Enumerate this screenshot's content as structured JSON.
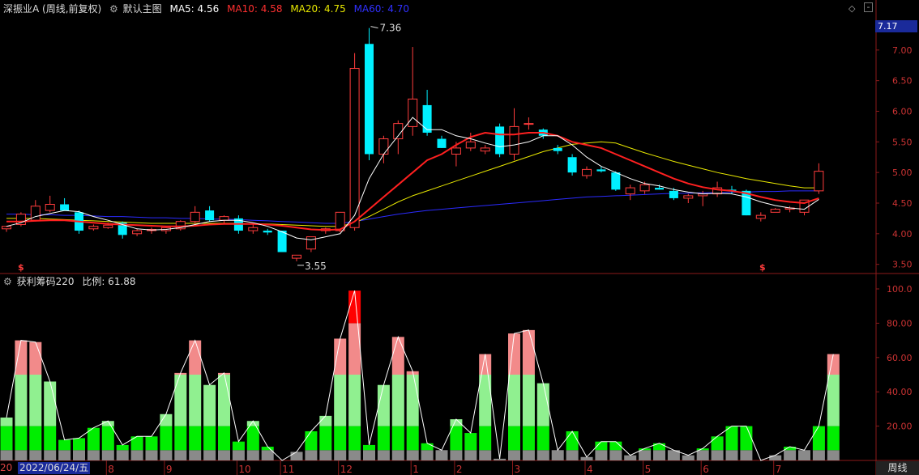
{
  "header": {
    "stock_name": "深振业A (周线,前复权)",
    "main_chart_label": "默认主图",
    "ma5": "MA5: 4.56",
    "ma10": "MA10: 4.58",
    "ma20": "MA20: 4.75",
    "ma60": "MA60: 4.70",
    "colors": {
      "ma5": "#ffffff",
      "ma10": "#ff2020",
      "ma20": "#e8e800",
      "ma60": "#2b2bff"
    }
  },
  "sub_header": {
    "indicator": "获利筹码220",
    "ratio": "比例: 61.88"
  },
  "current_price": "7.17",
  "price_axis": [
    "7.00",
    "6.50",
    "6.00",
    "5.50",
    "5.00",
    "4.50",
    "4.00",
    "3.50"
  ],
  "sub_axis": [
    "100.0",
    "80.00",
    "60.00",
    "40.00",
    "20.00"
  ],
  "annotations": {
    "high": "7.36",
    "low": "3.55"
  },
  "x_axis": {
    "date_label": "2022/06/24/五",
    "left_edge": "20",
    "months": [
      "8",
      "9",
      "10",
      "11",
      "12",
      "1",
      "2",
      "3",
      "4",
      "5",
      "6",
      "7"
    ]
  },
  "period_button": "周线",
  "chart_data": {
    "type": "candlestick",
    "price_ylim": [
      3.35,
      7.5
    ],
    "candles": [
      [
        4.08,
        4.13,
        4.03,
        4.12
      ],
      [
        4.15,
        4.35,
        4.12,
        4.32
      ],
      [
        4.22,
        4.55,
        4.2,
        4.45
      ],
      [
        4.38,
        4.62,
        4.35,
        4.48
      ],
      [
        4.48,
        4.58,
        4.38,
        4.38
      ],
      [
        4.35,
        4.38,
        4.0,
        4.05
      ],
      [
        4.08,
        4.15,
        4.05,
        4.12
      ],
      [
        4.1,
        4.18,
        4.08,
        4.14
      ],
      [
        4.18,
        4.2,
        3.92,
        3.98
      ],
      [
        4.0,
        4.08,
        3.96,
        4.05
      ],
      [
        4.05,
        4.1,
        4.0,
        4.07
      ],
      [
        4.05,
        4.12,
        4.0,
        4.1
      ],
      [
        4.08,
        4.22,
        4.05,
        4.2
      ],
      [
        4.2,
        4.45,
        4.15,
        4.35
      ],
      [
        4.38,
        4.45,
        4.2,
        4.22
      ],
      [
        4.22,
        4.3,
        4.15,
        4.28
      ],
      [
        4.25,
        4.3,
        4.0,
        4.05
      ],
      [
        4.05,
        4.15,
        4.0,
        4.1
      ],
      [
        4.05,
        4.08,
        3.98,
        4.02
      ],
      [
        4.05,
        4.05,
        3.7,
        3.7
      ],
      [
        3.6,
        3.65,
        3.55,
        3.65
      ],
      [
        3.75,
        3.95,
        3.7,
        3.95
      ],
      [
        4.05,
        4.1,
        4.0,
        4.08
      ],
      [
        4.05,
        4.35,
        4.02,
        4.35
      ],
      [
        4.1,
        6.95,
        4.05,
        6.7
      ],
      [
        7.1,
        7.36,
        5.2,
        5.3
      ],
      [
        5.3,
        5.6,
        5.15,
        5.55
      ],
      [
        5.55,
        5.85,
        5.3,
        5.8
      ],
      [
        5.75,
        7.05,
        5.6,
        6.2
      ],
      [
        6.1,
        6.35,
        5.6,
        5.65
      ],
      [
        5.55,
        5.6,
        5.4,
        5.4
      ],
      [
        5.3,
        5.5,
        5.1,
        5.4
      ],
      [
        5.4,
        5.65,
        5.35,
        5.5
      ],
      [
        5.35,
        5.45,
        5.3,
        5.4
      ],
      [
        5.75,
        5.8,
        5.25,
        5.3
      ],
      [
        5.3,
        6.05,
        5.2,
        5.75
      ],
      [
        5.8,
        5.9,
        5.7,
        5.8
      ],
      [
        5.7,
        5.72,
        5.55,
        5.6
      ],
      [
        5.4,
        5.45,
        5.3,
        5.35
      ],
      [
        5.25,
        5.3,
        4.95,
        5.0
      ],
      [
        4.95,
        5.1,
        4.9,
        5.05
      ],
      [
        5.05,
        5.1,
        5.0,
        5.02
      ],
      [
        5.0,
        5.02,
        4.7,
        4.72
      ],
      [
        4.65,
        4.8,
        4.55,
        4.75
      ],
      [
        4.7,
        4.85,
        4.65,
        4.8
      ],
      [
        4.75,
        4.8,
        4.72,
        4.72
      ],
      [
        4.7,
        4.75,
        4.55,
        4.58
      ],
      [
        4.58,
        4.65,
        4.5,
        4.62
      ],
      [
        4.62,
        4.7,
        4.45,
        4.65
      ],
      [
        4.65,
        4.85,
        4.6,
        4.75
      ],
      [
        4.72,
        4.78,
        4.65,
        4.7
      ],
      [
        4.7,
        4.72,
        4.3,
        4.3
      ],
      [
        4.25,
        4.35,
        4.2,
        4.3
      ],
      [
        4.35,
        4.42,
        4.35,
        4.4
      ],
      [
        4.4,
        4.45,
        4.35,
        4.42
      ],
      [
        4.35,
        4.55,
        4.3,
        4.55
      ],
      [
        4.7,
        5.15,
        4.65,
        5.02
      ]
    ],
    "ma5": [
      4.12,
      4.18,
      4.28,
      4.33,
      4.38,
      4.36,
      4.28,
      4.22,
      4.15,
      4.08,
      4.06,
      4.07,
      4.1,
      4.15,
      4.2,
      4.22,
      4.22,
      4.18,
      4.12,
      4.03,
      3.93,
      3.9,
      3.95,
      4.0,
      4.3,
      4.9,
      5.3,
      5.6,
      5.9,
      5.7,
      5.7,
      5.6,
      5.55,
      5.48,
      5.42,
      5.45,
      5.5,
      5.6,
      5.6,
      5.45,
      5.25,
      5.1,
      5.0,
      4.9,
      4.82,
      4.78,
      4.72,
      4.68,
      4.65,
      4.66,
      4.65,
      4.6,
      4.52,
      4.46,
      4.42,
      4.4,
      4.56
    ],
    "ma10": [
      4.2,
      4.2,
      4.21,
      4.22,
      4.22,
      4.2,
      4.18,
      4.16,
      4.15,
      4.14,
      4.13,
      4.12,
      4.12,
      4.13,
      4.15,
      4.16,
      4.16,
      4.16,
      4.15,
      4.13,
      4.1,
      4.07,
      4.06,
      4.07,
      4.2,
      4.4,
      4.6,
      4.8,
      5.0,
      5.2,
      5.3,
      5.45,
      5.58,
      5.65,
      5.62,
      5.62,
      5.65,
      5.65,
      5.6,
      5.5,
      5.45,
      5.4,
      5.3,
      5.2,
      5.1,
      5.0,
      4.9,
      4.82,
      4.76,
      4.72,
      4.7,
      4.66,
      4.6,
      4.55,
      4.52,
      4.5,
      4.58
    ],
    "ma20": [
      4.25,
      4.25,
      4.25,
      4.24,
      4.23,
      4.22,
      4.21,
      4.2,
      4.19,
      4.18,
      4.17,
      4.17,
      4.17,
      4.17,
      4.17,
      4.17,
      4.17,
      4.16,
      4.16,
      4.15,
      4.14,
      4.13,
      4.12,
      4.12,
      4.18,
      4.28,
      4.4,
      4.52,
      4.62,
      4.7,
      4.78,
      4.86,
      4.94,
      5.02,
      5.1,
      5.18,
      5.26,
      5.34,
      5.4,
      5.46,
      5.48,
      5.5,
      5.48,
      5.4,
      5.32,
      5.25,
      5.18,
      5.12,
      5.06,
      5.0,
      4.95,
      4.9,
      4.86,
      4.82,
      4.78,
      4.75,
      4.75
    ],
    "ma60": [
      4.32,
      4.32,
      4.31,
      4.31,
      4.3,
      4.3,
      4.29,
      4.28,
      4.28,
      4.27,
      4.26,
      4.26,
      4.25,
      4.25,
      4.24,
      4.24,
      4.23,
      4.22,
      4.21,
      4.2,
      4.19,
      4.18,
      4.17,
      4.17,
      4.2,
      4.24,
      4.28,
      4.32,
      4.35,
      4.38,
      4.4,
      4.42,
      4.44,
      4.46,
      4.48,
      4.5,
      4.52,
      4.54,
      4.56,
      4.58,
      4.6,
      4.61,
      4.62,
      4.63,
      4.64,
      4.65,
      4.66,
      4.66,
      4.67,
      4.67,
      4.68,
      4.68,
      4.69,
      4.69,
      4.7,
      4.7,
      4.7
    ],
    "profit_ylim": [
      0,
      100
    ],
    "profit_values": [
      25,
      70,
      69,
      46,
      12,
      13,
      19,
      23,
      9,
      14,
      14,
      27,
      51,
      70,
      44,
      51,
      11,
      23,
      8,
      0,
      5,
      17,
      26,
      71,
      99,
      9,
      44,
      72,
      52,
      10,
      6,
      24,
      16,
      62,
      1,
      74,
      76,
      45,
      6,
      17,
      2,
      11,
      11,
      3,
      7,
      10,
      6,
      3,
      7,
      14,
      20,
      20,
      0,
      3,
      8,
      6,
      20,
      62
    ]
  }
}
